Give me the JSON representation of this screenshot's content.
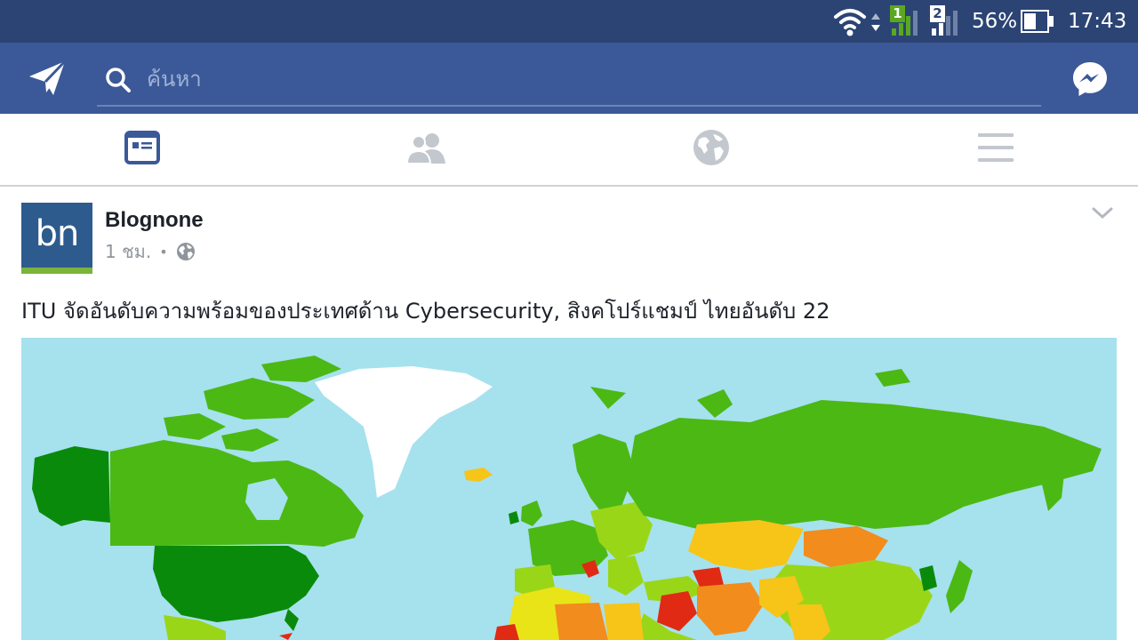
{
  "status_bar": {
    "sim1_label": "1",
    "sim2_label": "2",
    "battery_percent": "56%",
    "battery_level": 0.56,
    "time": "17:43",
    "background_color": "#2b4474"
  },
  "app_bar": {
    "background_color": "#3b5998",
    "left_icon": "paper-plane-icon",
    "search_placeholder": "ค้นหา",
    "search_value": "",
    "right_icon": "messenger-icon"
  },
  "tabs": [
    {
      "name": "news-feed",
      "icon": "news-feed-icon",
      "active": true,
      "color": "#3b5998"
    },
    {
      "name": "friends",
      "icon": "friends-icon",
      "active": false,
      "color": "#c3c7ce"
    },
    {
      "name": "notifications",
      "icon": "globe-icon",
      "active": false,
      "color": "#c3c7ce"
    },
    {
      "name": "menu",
      "icon": "hamburger-menu-icon",
      "active": false,
      "color": "#c3c7ce"
    }
  ],
  "post": {
    "page_avatar_text": "bn",
    "page_name": "Blognone",
    "time_ago": "1 ชม.",
    "separator": "•",
    "privacy_icon": "globe-icon",
    "menu_icon": "chevron-down-icon",
    "text": "ITU จัดอันดับความพร้อมของประเทศด้าน Cybersecurity, สิงคโปร์แชมป์ ไทยอันดับ 22",
    "image": {
      "description_icon": "world-map-image",
      "ocean_color": "#a6e1ee",
      "palette": [
        "#0a8a0a",
        "#4cb814",
        "#9ad618",
        "#e8e418",
        "#f7c418",
        "#f28c1c",
        "#e02a14",
        "#ffffff"
      ]
    }
  }
}
